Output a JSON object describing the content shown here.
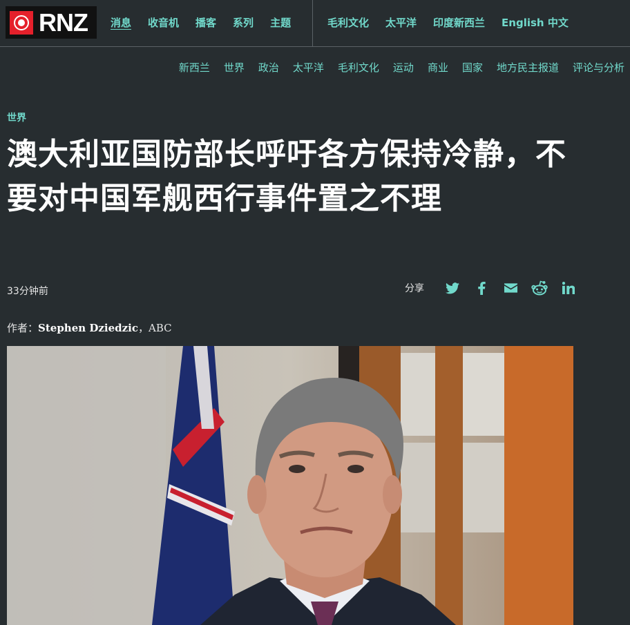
{
  "brand": {
    "logo_text": "RNZ"
  },
  "nav": {
    "primary": [
      "消息",
      "收音机",
      "播客",
      "系列",
      "主题"
    ],
    "secondary": [
      "毛利文化",
      "太平洋",
      "印度新西兰",
      "English 中文"
    ]
  },
  "subnav": [
    "新西兰",
    "世界",
    "政治",
    "太平洋",
    "毛利文化",
    "运动",
    "商业",
    "国家",
    "地方民主报道",
    "评论与分析"
  ],
  "article": {
    "section": "世界",
    "title": "澳大利亚国防部长呼吁各方保持冷静，不要对中国军舰西行事件置之不理",
    "time": "33分钟前",
    "share_label": "分享",
    "author_prefix": "作者：",
    "author_name": "Stephen Dziedzic",
    "author_suffix": "，ABC"
  },
  "share_icons": [
    "twitter-icon",
    "facebook-icon",
    "email-icon",
    "reddit-icon",
    "linkedin-icon"
  ],
  "colors": {
    "accent": "#71d9cb",
    "background": "#272d30",
    "brand_red": "#e5202b"
  }
}
